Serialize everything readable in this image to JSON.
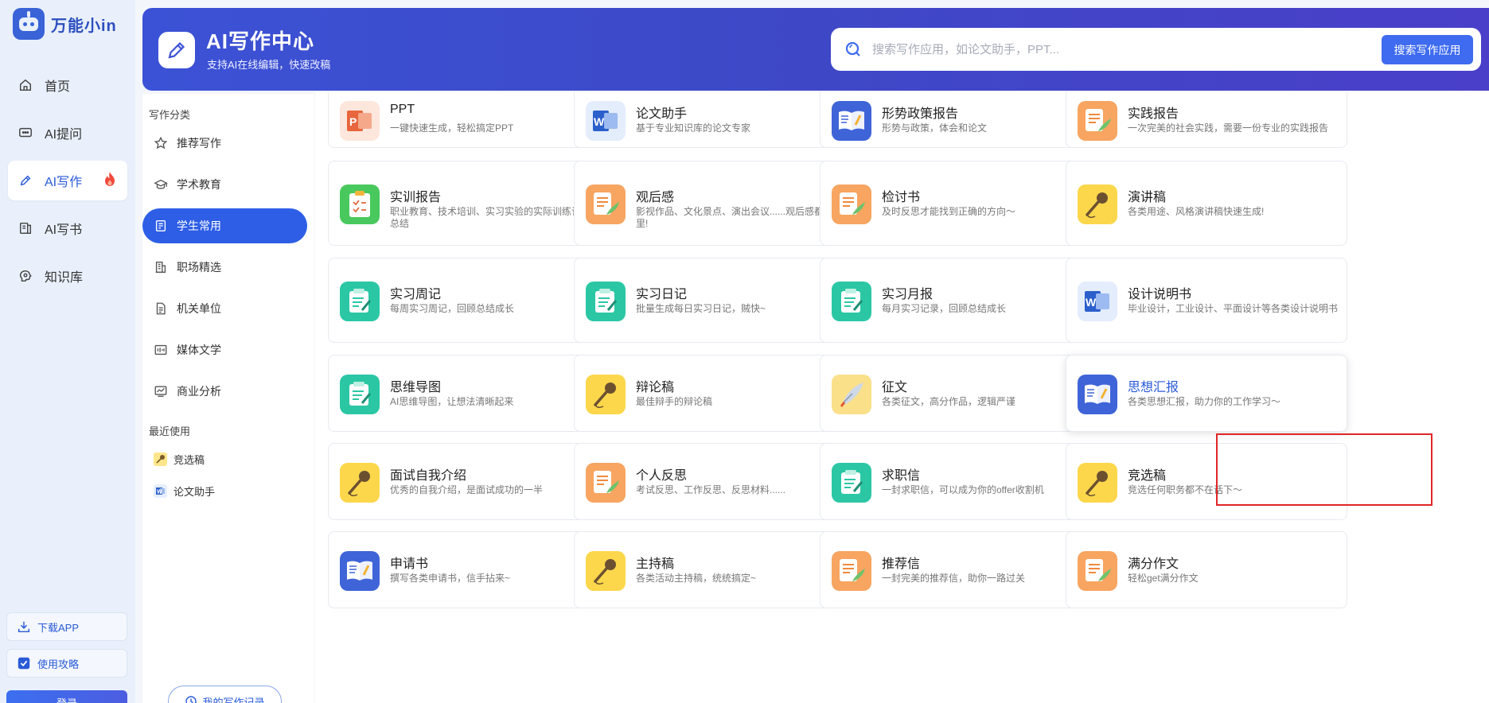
{
  "brand": {
    "name": "万能小in"
  },
  "nav": [
    {
      "label": "首页",
      "icon": "home-icon"
    },
    {
      "label": "AI提问",
      "icon": "chat-icon"
    },
    {
      "label": "AI写作",
      "icon": "pen-icon",
      "badge_icon": "fire-icon"
    },
    {
      "label": "AI写书",
      "icon": "book-icon"
    },
    {
      "label": "知识库",
      "icon": "brain-icon"
    }
  ],
  "side_buttons": {
    "download": "下载APP",
    "guide": "使用攻略"
  },
  "login_strip": "登录",
  "header": {
    "title": "AI写作中心",
    "subtitle": "支持AI在线编辑，快速改稿",
    "search_placeholder": "搜索写作应用，如论文助手，PPT...",
    "search_button": "搜索写作应用"
  },
  "categories": {
    "heading": "写作分类",
    "items": [
      {
        "label": "推荐写作",
        "icon": "star-icon"
      },
      {
        "label": "学术教育",
        "icon": "graduation-icon"
      },
      {
        "label": "学生常用",
        "icon": "student-icon"
      },
      {
        "label": "职场精选",
        "icon": "office-icon"
      },
      {
        "label": "机关单位",
        "icon": "document-icon"
      },
      {
        "label": "媒体文学",
        "icon": "media-icon"
      },
      {
        "label": "商业分析",
        "icon": "analysis-icon"
      }
    ],
    "recent_heading": "最近使用",
    "recent": [
      {
        "label": "竞选稿",
        "icon": "mic-icon"
      },
      {
        "label": "论文助手",
        "icon": "word-icon"
      }
    ],
    "history_button": "我的写作记录"
  },
  "cards": [
    {
      "title": "PPT",
      "desc": "一键快速生成，轻松搞定PPT",
      "icon": "ppt"
    },
    {
      "title": "论文助手",
      "desc": "基于专业知识库的论文专家",
      "icon": "word"
    },
    {
      "title": "形势政策报告",
      "desc": "形势与政策，体会和论文",
      "icon": "book"
    },
    {
      "title": "实践报告",
      "desc": "一次完美的社会实践，需要一份专业的实践报告",
      "icon": "report"
    },
    {
      "title": "实训报告",
      "desc": "职业教育、技术培训、实习实验的实际训练记录和总结",
      "icon": "clipboard"
    },
    {
      "title": "观后感",
      "desc": "影视作品、文化景点、演出会议......观后感都在这里!",
      "icon": "report"
    },
    {
      "title": "检讨书",
      "desc": "及时反思才能找到正确的方向～",
      "icon": "report"
    },
    {
      "title": "演讲稿",
      "desc": "各类用途、风格演讲稿快速生成!",
      "icon": "mic"
    },
    {
      "title": "实习周记",
      "desc": "每周实习周记，回顾总结成长",
      "icon": "notepad"
    },
    {
      "title": "实习日记",
      "desc": "批量生成每日实习日记，贼快~",
      "icon": "notepad"
    },
    {
      "title": "实习月报",
      "desc": "每月实习记录，回顾总结成长",
      "icon": "notepad"
    },
    {
      "title": "设计说明书",
      "desc": "毕业设计，工业设计、平面设计等各类设计说明书",
      "icon": "word"
    },
    {
      "title": "思维导图",
      "desc": "AI思维导图，让想法清晰起来",
      "icon": "notepad"
    },
    {
      "title": "辩论稿",
      "desc": "最佳辩手的辩论稿",
      "icon": "mic"
    },
    {
      "title": "征文",
      "desc": "各类征文，高分作品，逻辑严谨",
      "icon": "quill"
    },
    {
      "title": "思想汇报",
      "desc": "各类思想汇报，助力你的工作学习～",
      "icon": "book",
      "highlighted": true
    },
    {
      "title": "面试自我介绍",
      "desc": "优秀的自我介绍，是面试成功的一半",
      "icon": "mic"
    },
    {
      "title": "个人反思",
      "desc": "考试反思、工作反思、反思材料......",
      "icon": "report"
    },
    {
      "title": "求职信",
      "desc": "一封求职信，可以成为你的offer收割机",
      "icon": "notepad"
    },
    {
      "title": "竞选稿",
      "desc": "竞选任何职务都不在话下～",
      "icon": "mic"
    },
    {
      "title": "申请书",
      "desc": "撰写各类申请书，信手拈来~",
      "icon": "book"
    },
    {
      "title": "主持稿",
      "desc": "各类活动主持稿，统统搞定~",
      "icon": "mic"
    },
    {
      "title": "推荐信",
      "desc": "一封完美的推荐信，助你一路过关",
      "icon": "report"
    },
    {
      "title": "满分作文",
      "desc": "轻松get满分作文",
      "icon": "report"
    }
  ]
}
